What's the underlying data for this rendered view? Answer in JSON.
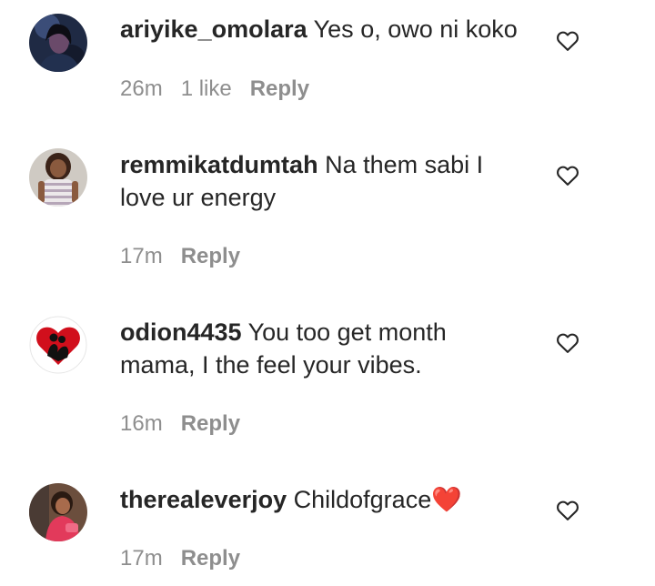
{
  "comments": [
    {
      "username": "ariyike_omolara",
      "text": "Yes o, owo ni koko",
      "time": "26m",
      "likes": "1 like",
      "reply": "Reply",
      "avatar": "woman-portrait-dark"
    },
    {
      "username": "remmikatdumtah",
      "text": "Na them sabi I love ur energy",
      "time": "17m",
      "likes": "",
      "reply": "Reply",
      "avatar": "woman-striped-top"
    },
    {
      "username": "odion4435",
      "text": "You too get month mama, I the feel your vibes.",
      "time": "16m",
      "likes": "",
      "reply": "Reply",
      "avatar": "red-heart-couple"
    },
    {
      "username": "therealeverjoy",
      "text": "Childofgrace❤️",
      "time": "17m",
      "likes": "",
      "reply": "Reply",
      "avatar": "woman-pink-outfit"
    }
  ],
  "icons": {
    "like": "heart-outline-icon"
  },
  "colors": {
    "primary_text": "#262626",
    "secondary_text": "#8e8e8e"
  }
}
